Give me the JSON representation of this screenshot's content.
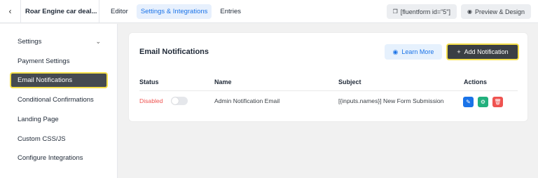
{
  "topbar": {
    "back_icon": "chevron-left-icon",
    "form_title": "Roar Engine car deal...",
    "tabs": [
      {
        "label": "Editor",
        "active": false
      },
      {
        "label": "Settings & Integrations",
        "active": true
      },
      {
        "label": "Entries",
        "active": false
      }
    ],
    "shortcode": "[fluentform id=\"5\"]",
    "preview_label": "Preview & Design"
  },
  "sidebar": {
    "items": [
      {
        "label": "Settings",
        "has_chevron": true
      },
      {
        "label": "Payment Settings"
      },
      {
        "label": "Email Notifications",
        "active": true
      },
      {
        "label": "Conditional Confirmations"
      },
      {
        "label": "Landing Page"
      },
      {
        "label": "Custom CSS/JS"
      },
      {
        "label": "Configure Integrations"
      }
    ]
  },
  "main": {
    "title": "Email Notifications",
    "learn_more_label": "Learn More",
    "add_notification_label": "Add Notification",
    "table": {
      "headers": [
        "Status",
        "Name",
        "Subject",
        "Actions"
      ],
      "rows": [
        {
          "status": "Disabled",
          "enabled": false,
          "name": "Admin Notification Email",
          "subject": "[{inputs.names}] New Form Submission"
        }
      ]
    }
  },
  "colors": {
    "accent": "#1a73e8",
    "highlight": "#f6e04b",
    "dark_button": "#3b3f44",
    "disabled_text": "#ef5350",
    "edit_action": "#1a73e8",
    "settings_action": "#22b07d",
    "delete_action": "#ef5350"
  }
}
